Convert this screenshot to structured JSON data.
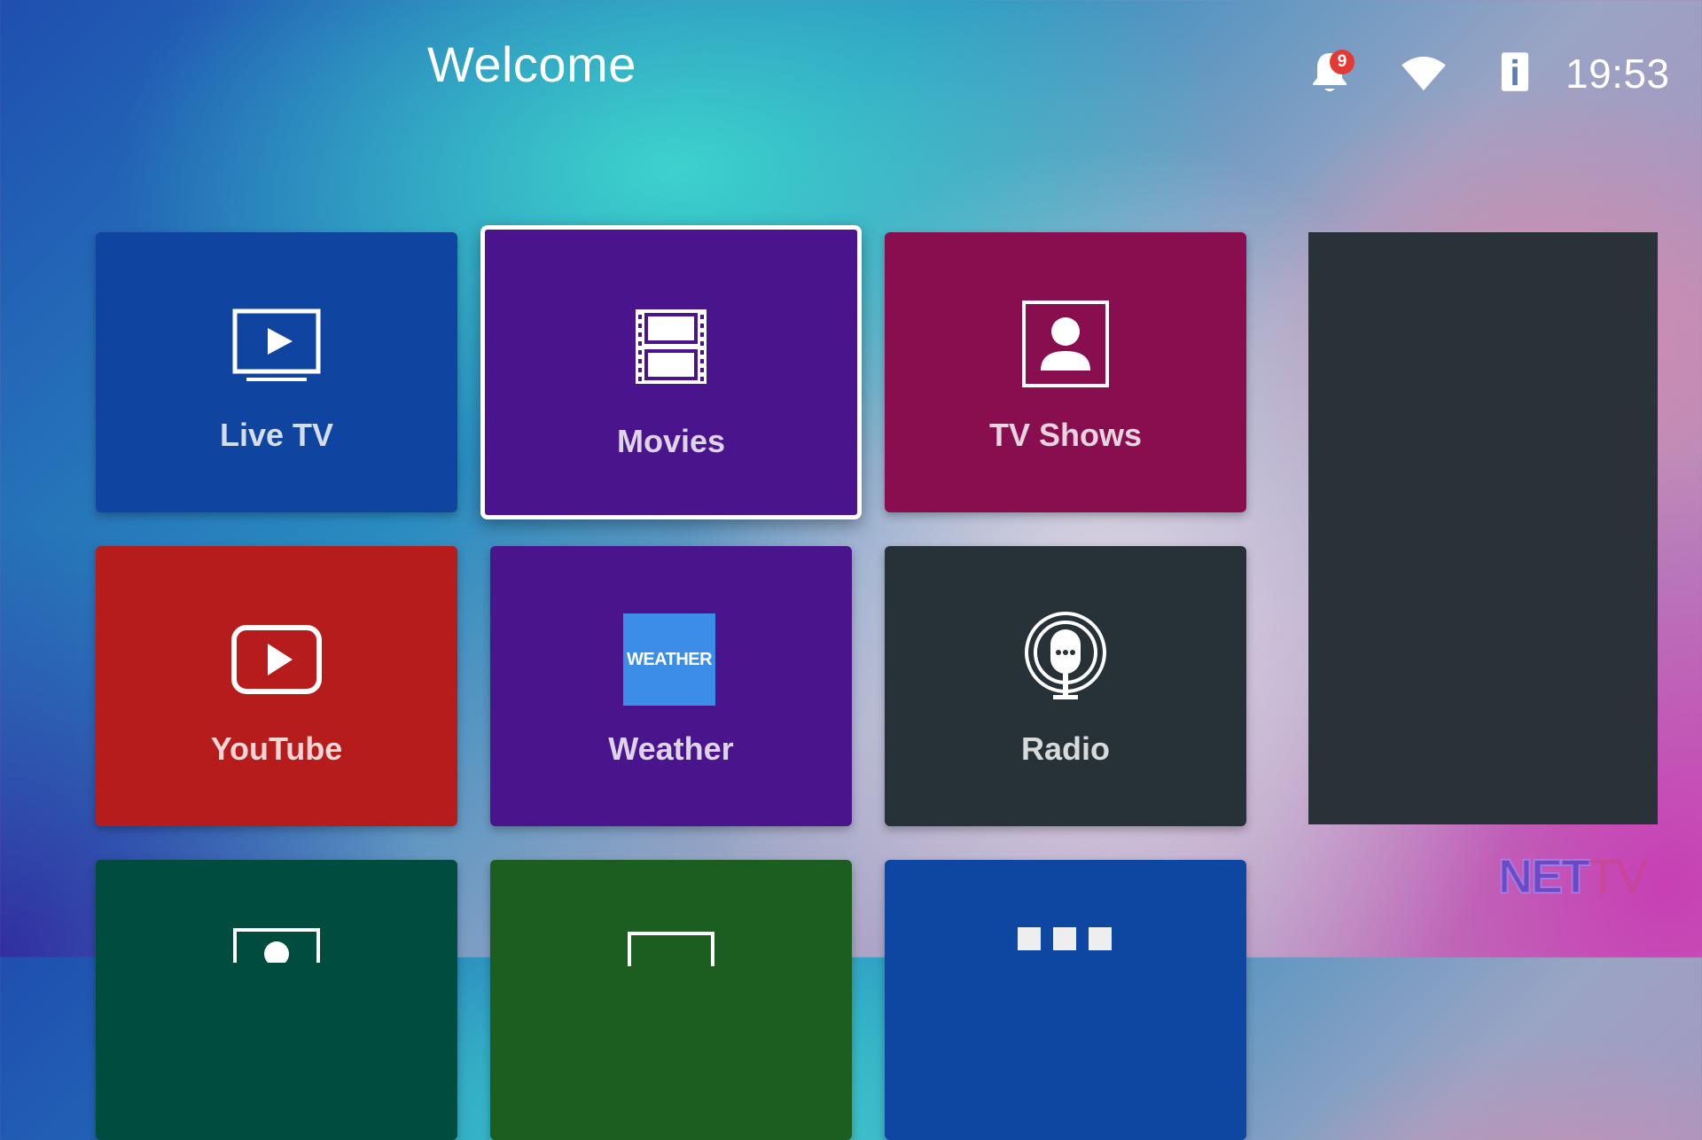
{
  "header": {
    "title": "Welcome",
    "notification_count": "9",
    "clock": "19:53"
  },
  "tiles": [
    {
      "label": "Live TV",
      "icon": "tv-play-icon",
      "color": "#0f44a0"
    },
    {
      "label": "Movies",
      "icon": "film-strip-icon",
      "color": "#4a148c",
      "focused": true
    },
    {
      "label": "TV Shows",
      "icon": "user-portrait-icon",
      "color": "#880e4f"
    },
    {
      "label": "YouTube",
      "icon": "youtube-play-icon",
      "color": "#b71c1c"
    },
    {
      "label": "Weather",
      "icon": "weather-logo-icon",
      "color": "#4a148c",
      "icon_text": "WEATHER"
    },
    {
      "label": "Radio",
      "icon": "podcast-mic-icon",
      "color": "#263238"
    },
    {
      "label": "",
      "icon": "portrait-icon",
      "color": "#004d40"
    },
    {
      "label": "",
      "icon": "screen-icon",
      "color": "#1b5e20"
    },
    {
      "label": "",
      "icon": "more-apps-icon",
      "color": "#0d47a1"
    }
  ],
  "side_panel": {
    "color": "#283238"
  },
  "logo": {
    "text_a": "NET",
    "text_b": "TV"
  }
}
